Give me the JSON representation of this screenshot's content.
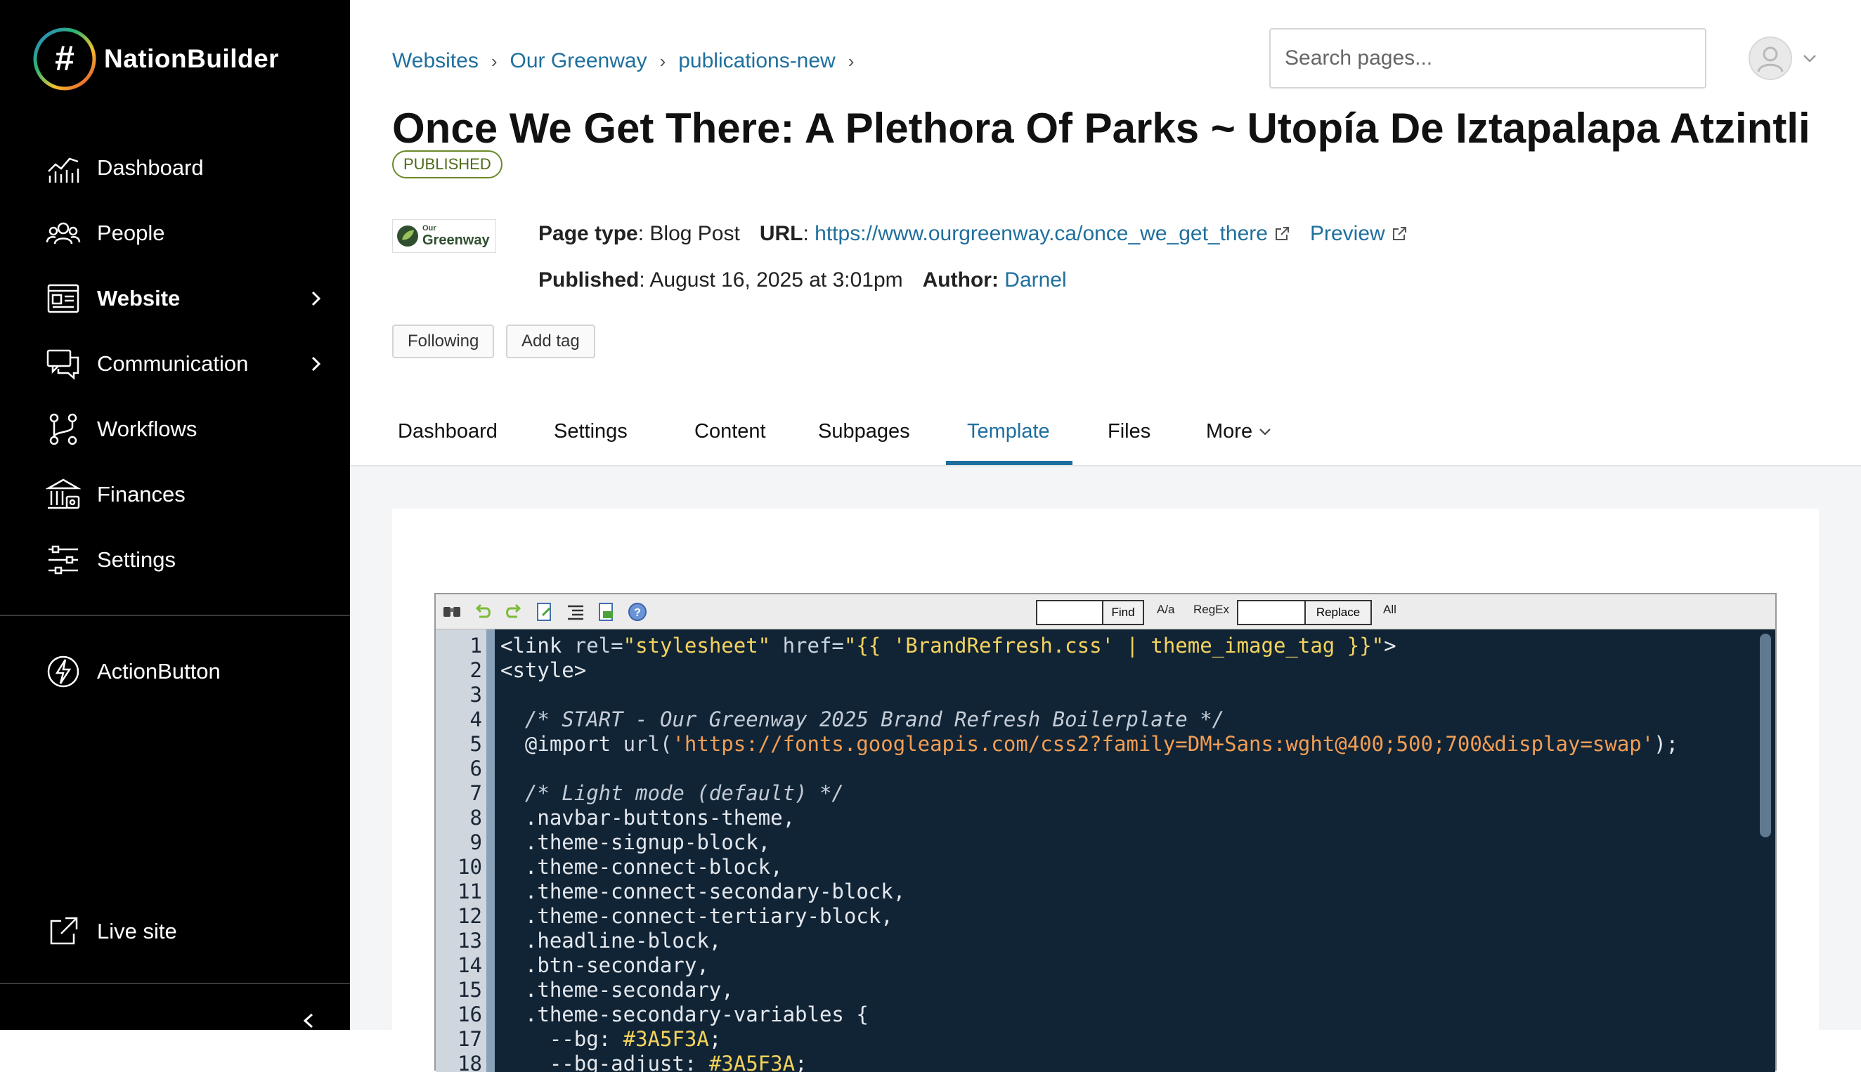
{
  "brand": {
    "name": "NationBuilder",
    "logo_glyph": "#"
  },
  "sidebar": {
    "items": [
      {
        "label": "Dashboard",
        "icon": "chart-icon"
      },
      {
        "label": "People",
        "icon": "people-icon"
      },
      {
        "label": "Website",
        "icon": "website-icon",
        "active": true
      },
      {
        "label": "Communication",
        "icon": "chat-icon"
      },
      {
        "label": "Workflows",
        "icon": "workflow-icon"
      },
      {
        "label": "Finances",
        "icon": "bank-icon"
      },
      {
        "label": "Settings",
        "icon": "sliders-icon"
      }
    ],
    "action_button": "ActionButton",
    "live_site": "Live site"
  },
  "breadcrumb": [
    "Websites",
    "Our Greenway",
    "publications-new"
  ],
  "search": {
    "placeholder": "Search pages..."
  },
  "page": {
    "title": "Once We Get There: A Plethora Of Parks ~ Utopía De Iztapalapa Atzintli",
    "status": "PUBLISHED",
    "site_logo": {
      "small": "Our",
      "big": "Greenway"
    },
    "page_type_label": "Page type",
    "page_type": ": Blog Post",
    "url_label": "URL",
    "colon": ":",
    "url": "https://www.ourgreenway.ca/once_we_get_there",
    "preview": "Preview",
    "published_label": "Published",
    "published": ": August 16, 2025 at 3:01pm",
    "author_label": "Author:",
    "author": "Darnel",
    "tags": {
      "following": "Following",
      "add_tag": "Add tag"
    }
  },
  "tabs": [
    "Dashboard",
    "Settings",
    "Content",
    "Subpages",
    "Template",
    "Files",
    "More"
  ],
  "active_tab": "Template",
  "editor": {
    "toolbar": {
      "find": "Find",
      "match_case": "A/a",
      "regex": "RegEx",
      "replace": "Replace",
      "all": "All"
    },
    "lines": [
      {
        "n": "1",
        "parts": [
          [
            "",
            "<link "
          ],
          [
            "attr",
            "rel="
          ],
          [
            "str",
            "\"stylesheet\""
          ],
          [
            "attr",
            " href="
          ],
          [
            "str",
            "\"{{ 'BrandRefresh.css' | theme_image_tag }}\""
          ],
          [
            "",
            ">"
          ]
        ]
      },
      {
        "n": "2",
        "parts": [
          [
            "",
            "<style>"
          ]
        ]
      },
      {
        "n": "3",
        "parts": [
          [
            "",
            ""
          ]
        ]
      },
      {
        "n": "4",
        "parts": [
          [
            "comment",
            "  /* START - Our Greenway 2025 Brand Refresh Boilerplate */"
          ]
        ]
      },
      {
        "n": "5",
        "parts": [
          [
            "",
            "  @import "
          ],
          [
            "attr",
            "url("
          ],
          [
            "url",
            "'https://fonts.googleapis.com/css2?family=DM+Sans:wght@400;500;700&display=swap'"
          ],
          [
            "",
            ");"
          ]
        ]
      },
      {
        "n": "6",
        "parts": [
          [
            "",
            ""
          ]
        ]
      },
      {
        "n": "7",
        "parts": [
          [
            "comment",
            "  /* Light mode (default) */"
          ]
        ]
      },
      {
        "n": "8",
        "parts": [
          [
            "",
            "  .navbar-buttons-theme,"
          ]
        ]
      },
      {
        "n": "9",
        "parts": [
          [
            "",
            "  .theme-signup-block,"
          ]
        ]
      },
      {
        "n": "10",
        "parts": [
          [
            "",
            "  .theme-connect-block,"
          ]
        ]
      },
      {
        "n": "11",
        "parts": [
          [
            "",
            "  .theme-connect-secondary-block,"
          ]
        ]
      },
      {
        "n": "12",
        "parts": [
          [
            "",
            "  .theme-connect-tertiary-block,"
          ]
        ]
      },
      {
        "n": "13",
        "parts": [
          [
            "",
            "  .headline-block,"
          ]
        ]
      },
      {
        "n": "14",
        "parts": [
          [
            "",
            "  .btn-secondary,"
          ]
        ]
      },
      {
        "n": "15",
        "parts": [
          [
            "",
            "  .theme-secondary,"
          ]
        ]
      },
      {
        "n": "16",
        "parts": [
          [
            "",
            "  .theme-secondary-variables {"
          ]
        ]
      },
      {
        "n": "17",
        "parts": [
          [
            "",
            "    --bg: "
          ],
          [
            "hex",
            "#3A5F3A"
          ],
          [
            "",
            ";"
          ]
        ]
      },
      {
        "n": "18",
        "parts": [
          [
            "",
            "    --bg-adjust: "
          ],
          [
            "hex",
            "#3A5F3A"
          ],
          [
            "",
            ";"
          ]
        ]
      }
    ]
  },
  "colors": {
    "accent": "#1f6f9e",
    "sidebar_bg": "#000000",
    "editor_bg": "#112435",
    "badge": "#4e6b18"
  }
}
